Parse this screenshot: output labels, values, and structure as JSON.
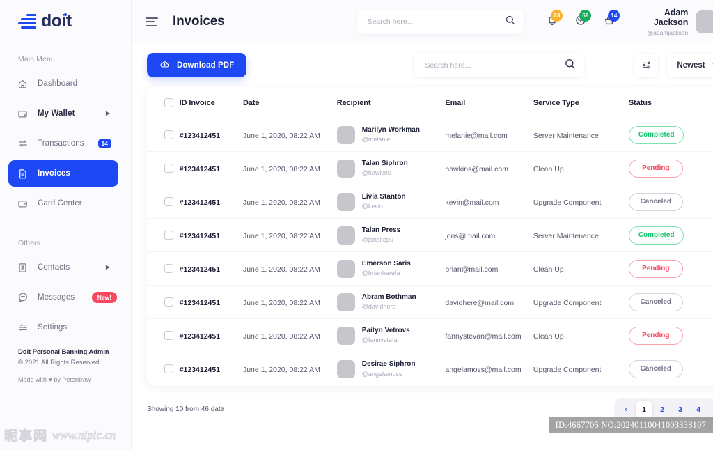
{
  "brand": {
    "name": "doit",
    "primary": "#1f48f5",
    "navy": "#25305c"
  },
  "sidebar": {
    "section_main": "Main Menu",
    "section_others": "Others",
    "items": [
      {
        "label": "Dashboard",
        "icon": "home-icon",
        "badge": "",
        "caret": false,
        "active": false,
        "bold": false
      },
      {
        "label": "My Wallet",
        "icon": "wallet-icon",
        "badge": "",
        "caret": true,
        "active": false,
        "bold": true
      },
      {
        "label": "Transactions",
        "icon": "transfer-icon",
        "badge": "14",
        "caret": false,
        "active": false,
        "bold": false
      },
      {
        "label": "Invoices",
        "icon": "document-icon",
        "badge": "",
        "caret": false,
        "active": true,
        "bold": false
      },
      {
        "label": "Card Center",
        "icon": "card-icon",
        "badge": "",
        "caret": false,
        "active": false,
        "bold": false
      }
    ],
    "others": [
      {
        "label": "Contacts",
        "icon": "contacts-icon",
        "badge": "",
        "caret": true,
        "new": false
      },
      {
        "label": "Messages",
        "icon": "message-icon",
        "badge": "New!",
        "caret": false,
        "new": true
      },
      {
        "label": "Settings",
        "icon": "sliders-icon",
        "badge": "",
        "caret": false,
        "new": false
      }
    ],
    "footer": {
      "line1": "Doit Personal Banking Admin",
      "line2": "© 2021 All Rights Reserved",
      "line3": "Made with ♥ by Peterdraw"
    }
  },
  "header": {
    "title": "Invoices",
    "search_placeholder": "Search here...",
    "notifications": [
      {
        "icon": "bell-icon",
        "count": "23",
        "color": "#f7b32b"
      },
      {
        "icon": "mail-icon",
        "count": "68",
        "color": "#14ae5c"
      },
      {
        "icon": "basket-icon",
        "count": "14",
        "color": "#1f48f5"
      }
    ],
    "user": {
      "name": "Adam Jackson",
      "handle": "@adamjackson"
    }
  },
  "toolbar": {
    "download_label": "Download PDF",
    "search_placeholder": "Search here...",
    "sort_label": "Newest"
  },
  "table": {
    "columns": [
      "ID Invoice",
      "Date",
      "Recipient",
      "Email",
      "Service Type",
      "Status"
    ],
    "rows": [
      {
        "id": "#123412451",
        "date": "June 1, 2020, 08:22 AM",
        "name": "Marilyn Workman",
        "handle": "@melanie",
        "email": "melanie@mail.com",
        "service": "Server Maintenance",
        "status": "Completed",
        "status_key": "completed"
      },
      {
        "id": "#123412451",
        "date": "June 1, 2020, 08:22 AM",
        "name": "Talan Siphron",
        "handle": "@hawkins",
        "email": "hawkins@mail.com",
        "service": "Clean Up",
        "status": "Pending",
        "status_key": "pending"
      },
      {
        "id": "#123412451",
        "date": "June 1, 2020, 08:22 AM",
        "name": "Livia Stanton",
        "handle": "@kevin",
        "email": "kevin@mail.com",
        "service": "Upgrade Component",
        "status": "Canceled",
        "status_key": "canceled"
      },
      {
        "id": "#123412451",
        "date": "June 1, 2020, 08:22 AM",
        "name": "Talan Press",
        "handle": "@jonsitepu",
        "email": "jons@mail.com",
        "service": "Server Maintenance",
        "status": "Completed",
        "status_key": "completed"
      },
      {
        "id": "#123412451",
        "date": "June 1, 2020, 08:22 AM",
        "name": "Emerson Saris",
        "handle": "@brianharefa",
        "email": "brian@mail.com",
        "service": "Clean Up",
        "status": "Pending",
        "status_key": "pending"
      },
      {
        "id": "#123412451",
        "date": "June 1, 2020, 08:22 AM",
        "name": "Abram Bothman",
        "handle": "@davidhere",
        "email": "davidhere@mail.com",
        "service": "Upgrade Component",
        "status": "Canceled",
        "status_key": "canceled"
      },
      {
        "id": "#123412451",
        "date": "June 1, 2020, 08:22 AM",
        "name": "Paityn Vetrovs",
        "handle": "@fannystefan",
        "email": "fannystevan@mail.com",
        "service": "Clean Up",
        "status": "Pending",
        "status_key": "pending"
      },
      {
        "id": "#123412451",
        "date": "June 1, 2020, 08:22 AM",
        "name": "Desirae Siphron",
        "handle": "@angelamoss",
        "email": "angelamoss@mail.com",
        "service": "Upgrade Component",
        "status": "Canceled",
        "status_key": "canceled"
      }
    ]
  },
  "footer": {
    "showing": "Showing 10 from 46 data",
    "pages": [
      "1",
      "2",
      "3",
      "4"
    ],
    "active_page": "1",
    "prev": "‹",
    "next": "›"
  },
  "watermark": {
    "cn": "昵享网",
    "url": "www.nipic.cn",
    "id_text": "ID:4667705 NO:20240110041003338107"
  }
}
